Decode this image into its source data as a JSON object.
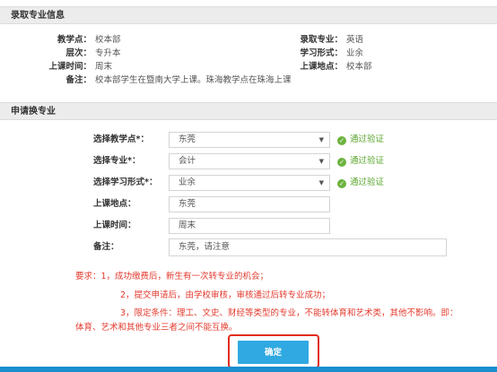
{
  "admission": {
    "title": "录取专业信息",
    "rows": [
      {
        "label": "教学点：",
        "value": "校本部"
      },
      {
        "label": "层次：",
        "value": "专升本"
      },
      {
        "label": "上课时间：",
        "value": "周末"
      },
      {
        "label": "备注：",
        "value": "校本部学生在暨南大学上课。珠海教学点在珠海上课"
      }
    ],
    "right_rows": [
      {
        "label": "录取专业：",
        "value": "英语"
      },
      {
        "label": "学习形式：",
        "value": "业余"
      },
      {
        "label": "上课地点：",
        "value": "校本部"
      }
    ]
  },
  "transfer": {
    "title": "申请换专业",
    "fields": {
      "campus": {
        "label": "选择教学点*：",
        "value": "东莞",
        "valid": "通过验证"
      },
      "major": {
        "label": "选择专业*：",
        "value": "会计",
        "valid": "通过验证"
      },
      "mode": {
        "label": "选择学习形式*：",
        "value": "业余",
        "valid": "通过验证"
      },
      "location": {
        "label": "上课地点：",
        "value": "东莞"
      },
      "time": {
        "label": "上课时间：",
        "value": "周末"
      },
      "note": {
        "label": "备注：",
        "value": "东莞，请注意"
      }
    },
    "notices": {
      "line1": "要求：1，成功缴费后，新生有一次转专业的机会；",
      "line2": "2，提交申请后，由学校审核，审核通过后转专业成功；",
      "line3": "3，限定条件：理工、文史、财经等类型的专业，不能转体育和艺术类，其他不影响。即：",
      "line4": "体育、艺术和其他专业三者之间不能互换。"
    },
    "confirm_label": "确定"
  },
  "colors": {
    "accent": "#30a9e2",
    "valid": "#5aa52c",
    "notice": "#e33b2f",
    "highlight": "#e32b1d",
    "bar": "#1a8fd0"
  }
}
